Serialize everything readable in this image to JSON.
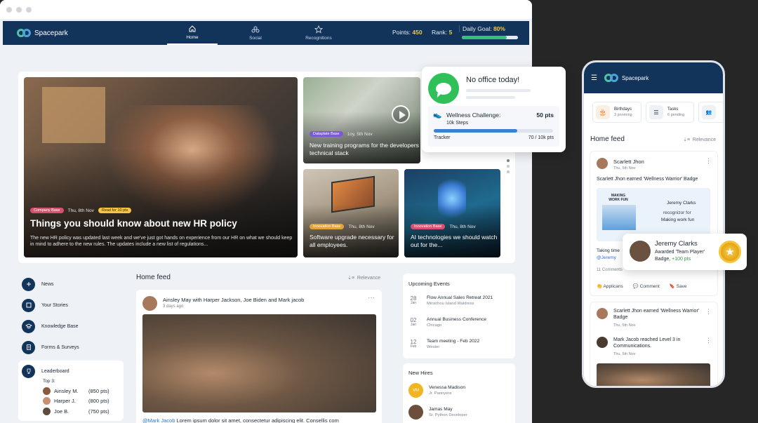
{
  "app": {
    "name": "Spacepark"
  },
  "nav": {
    "tabs": [
      {
        "label": "Home",
        "icon": "home-icon"
      },
      {
        "label": "Social",
        "icon": "social-icon"
      },
      {
        "label": "Recognitions",
        "icon": "star-icon"
      }
    ],
    "points_label": "Points:",
    "points_value": "450",
    "rank_label": "Rank:",
    "rank_value": "5",
    "goal_label": "Daily Goal:",
    "goal_value": "80%",
    "goal_fraction": 0.8
  },
  "hero": {
    "main": {
      "tag": "Company Base",
      "date": "Thu, 8th Nov",
      "badge": "Read for 10 pts",
      "title": "Things you should know about new HR policy",
      "body": "The new HR policy was updated last week and we've just got hands on experience from our HR on what we should keep in mind to adhere to the new rules. The updates include a new list of regulations..."
    },
    "video": {
      "tag": "Dataplate Base",
      "date": "1oy, 5th Nov",
      "title": "New training programs for the developers technical stack"
    },
    "laptop": {
      "tag": "Innovation Base",
      "date": "Thu, 8th Nov",
      "title": "Software upgrade necessary for all employees."
    },
    "ai": {
      "tag": "Innovation Base",
      "date": "Thu, 8th Nov",
      "title": "AI technologies we should watch out for the..."
    }
  },
  "sidebar": {
    "items": [
      {
        "label": "News",
        "icon": "news-icon"
      },
      {
        "label": "Your Stories",
        "icon": "stories-icon"
      },
      {
        "label": "Knowledge Base",
        "icon": "book-icon"
      },
      {
        "label": "Forms & Surveys",
        "icon": "form-icon"
      }
    ],
    "leaderboard": {
      "title": "Leaderboard",
      "subtitle": "Top 3:",
      "rows": [
        {
          "name": "Ainsley M.",
          "pts": "(850 pts)"
        },
        {
          "name": "Harper J.",
          "pts": "(800 pts)"
        },
        {
          "name": "Joe B.",
          "pts": "(750 pts)"
        }
      ]
    }
  },
  "feed": {
    "title": "Home feed",
    "sort": "Relevance",
    "post": {
      "author": "Ainsley May with Harper Jackson, Joe Biden and Mark jacob",
      "time": "3 days ago",
      "mention": "@Mark Jacob",
      "text": "Lorem ipsum dolor sit amet, consectetur adipiscing elit. Consellis com"
    }
  },
  "events": {
    "title": "Upcoming Events",
    "items": [
      {
        "day": "28",
        "month": "Jan",
        "name": "Flow Annual Sales Retreat 2021",
        "place": "Mirsichou Island Waldress"
      },
      {
        "day": "02",
        "month": "Jan",
        "name": "Annual Business Conference",
        "place": "Chicago"
      },
      {
        "day": "12",
        "month": "Feb",
        "name": "Team meeting - Feb 2022",
        "place": "Wester"
      }
    ]
  },
  "hires": {
    "title": "New Hires",
    "items": [
      {
        "initials": "VM",
        "name": "Venessa Madison",
        "role": "Jr. Pannyere"
      },
      {
        "initials": "JM",
        "name": "Jamas May",
        "role": "Sr. Python Developer"
      }
    ]
  },
  "popup": {
    "title": "No office today!",
    "challenge": "Wellness Challenge:",
    "challenge_pts": "50 pts",
    "steps": "10k Steps",
    "tracker": "Tracker",
    "tracker_value": "70 / 10k pts",
    "progress": 0.7
  },
  "phone": {
    "title": "Spacepark",
    "chips": [
      {
        "label": "Birthdays",
        "sub": "3 pnnming"
      },
      {
        "label": "Tasks",
        "sub": "6 pending"
      }
    ],
    "feed_title": "Home feed",
    "sort": "Relevance",
    "post1": {
      "author": "Scarlett Jhon",
      "date": "Thu, 5th Nov",
      "text": "Scarlett Jhon earned 'Wellness Warrior' Badge",
      "img_title": "MAKING WORK FUN",
      "img_name": "Jeremy Clarks",
      "img_role": "recognizor for",
      "img_desc": "Making work fun",
      "caption": "Taking time",
      "mention": "@Jeremy",
      "comments": "11 Comments",
      "actions": [
        "Applicans",
        "Comment",
        "Save"
      ]
    },
    "post2": {
      "text": "Scarlett Jhon earned 'Wellness Warrior' Badge",
      "date": "Thu, 5th Nov",
      "text2": "Mark Jacob reached Level 3 in Communications.",
      "date2": "Thu, 5th Nov"
    }
  },
  "award": {
    "name": "Jeremy Clarks",
    "line1": "Awarded 'Team Player'",
    "line2": "Badge, ",
    "pts": "+100 pts"
  }
}
